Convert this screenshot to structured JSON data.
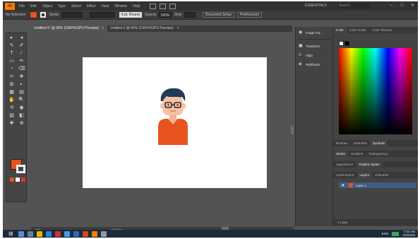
{
  "app": {
    "logo": "Ai"
  },
  "menubar": {
    "items": [
      "File",
      "Edit",
      "Object",
      "Type",
      "Select",
      "Effect",
      "View",
      "Window",
      "Help"
    ],
    "workspace": "ESSENTIALS",
    "search_placeholder": "Search",
    "window_controls": {
      "minimize": "–",
      "maximize": "□",
      "close": "✕"
    }
  },
  "controlbar": {
    "selection_label": "No Selection",
    "stroke_label": "Stroke",
    "stroke_value": "",
    "uniform_label": "5 pt. Round",
    "opacity_label": "Opacity",
    "opacity_value": "100%",
    "style_label": "Style",
    "doc_setup": "Document Setup",
    "preferences": "Preferences"
  },
  "doc_tabs": [
    {
      "label": "Untitled-1* @ 66% (CMYK/GPU Preview)",
      "active": true
    },
    {
      "label": "Untitled-2 @ 66% (CMYK/GPU Preview)",
      "active": false
    }
  ],
  "toolbar": {
    "tools": [
      "▸",
      "◂",
      "✎",
      "✐",
      "T",
      "⁄",
      "▭",
      "✏",
      "◔",
      "⌫",
      "✂",
      "✥",
      "⊞",
      "◐",
      "▦",
      "▤",
      "✋",
      "🔍",
      "⟲",
      "◉",
      "▧",
      "◧",
      "✚",
      "⊕"
    ],
    "fill_color": "#e8531f",
    "stroke_color": "#f2f2f2"
  },
  "statusbar": {
    "zoom": "66%",
    "tool": "Selection"
  },
  "midpanel": {
    "items": [
      {
        "icon": "image-trace-icon",
        "glyph": "◉",
        "label": "Image Tra..."
      },
      {
        "icon": "transform-icon",
        "glyph": "▣",
        "label": "Transform"
      },
      {
        "icon": "align-icon",
        "glyph": "≡",
        "label": "Align"
      },
      {
        "icon": "pathfinder-icon",
        "glyph": "◈",
        "label": "Pathfinder"
      }
    ]
  },
  "rightpanel": {
    "color_tabs": [
      "Color",
      "Color Guide",
      "Color Themes"
    ],
    "brush_tabs": [
      "Brushes",
      "Swatches",
      "Symbols"
    ],
    "stroke_tabs": [
      "Stroke",
      "Gradient",
      "Transparency"
    ],
    "appearance_tabs": [
      "Appearance",
      "Graphic Styles"
    ],
    "layers_tabs": [
      "Asset Export",
      "Layers",
      "Artboards"
    ],
    "layer_name": "Layer 1",
    "layers_count": "1 Layer"
  },
  "taskbar": {
    "start_glyph": "⊞",
    "time": "7:02 AM",
    "date": "2/3/2020",
    "lang": "ENG"
  }
}
